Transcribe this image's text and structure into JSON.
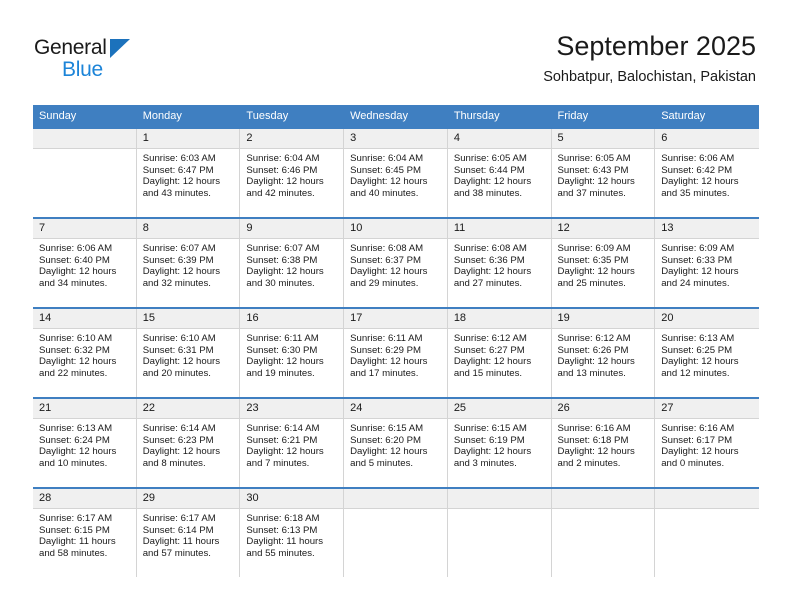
{
  "brand": {
    "name_top": "General",
    "name_bottom": "Blue",
    "accent_color": "#1c84d8",
    "logo_triangle_color": "#1c72bc"
  },
  "header": {
    "title": "September 2025",
    "subtitle": "Sohbatpur, Balochistan, Pakistan",
    "header_bg_color": "#3f7fc1"
  },
  "calendar": {
    "weekday_headers": [
      "Sunday",
      "Monday",
      "Tuesday",
      "Wednesday",
      "Thursday",
      "Friday",
      "Saturday"
    ],
    "weeks": [
      [
        {
          "day": "",
          "empty": true
        },
        {
          "day": "1",
          "sunrise": "Sunrise: 6:03 AM",
          "sunset": "Sunset: 6:47 PM",
          "daylight_line1": "Daylight: 12 hours",
          "daylight_line2": "and 43 minutes."
        },
        {
          "day": "2",
          "sunrise": "Sunrise: 6:04 AM",
          "sunset": "Sunset: 6:46 PM",
          "daylight_line1": "Daylight: 12 hours",
          "daylight_line2": "and 42 minutes."
        },
        {
          "day": "3",
          "sunrise": "Sunrise: 6:04 AM",
          "sunset": "Sunset: 6:45 PM",
          "daylight_line1": "Daylight: 12 hours",
          "daylight_line2": "and 40 minutes."
        },
        {
          "day": "4",
          "sunrise": "Sunrise: 6:05 AM",
          "sunset": "Sunset: 6:44 PM",
          "daylight_line1": "Daylight: 12 hours",
          "daylight_line2": "and 38 minutes."
        },
        {
          "day": "5",
          "sunrise": "Sunrise: 6:05 AM",
          "sunset": "Sunset: 6:43 PM",
          "daylight_line1": "Daylight: 12 hours",
          "daylight_line2": "and 37 minutes."
        },
        {
          "day": "6",
          "sunrise": "Sunrise: 6:06 AM",
          "sunset": "Sunset: 6:42 PM",
          "daylight_line1": "Daylight: 12 hours",
          "daylight_line2": "and 35 minutes."
        }
      ],
      [
        {
          "day": "7",
          "sunrise": "Sunrise: 6:06 AM",
          "sunset": "Sunset: 6:40 PM",
          "daylight_line1": "Daylight: 12 hours",
          "daylight_line2": "and 34 minutes."
        },
        {
          "day": "8",
          "sunrise": "Sunrise: 6:07 AM",
          "sunset": "Sunset: 6:39 PM",
          "daylight_line1": "Daylight: 12 hours",
          "daylight_line2": "and 32 minutes."
        },
        {
          "day": "9",
          "sunrise": "Sunrise: 6:07 AM",
          "sunset": "Sunset: 6:38 PM",
          "daylight_line1": "Daylight: 12 hours",
          "daylight_line2": "and 30 minutes."
        },
        {
          "day": "10",
          "sunrise": "Sunrise: 6:08 AM",
          "sunset": "Sunset: 6:37 PM",
          "daylight_line1": "Daylight: 12 hours",
          "daylight_line2": "and 29 minutes."
        },
        {
          "day": "11",
          "sunrise": "Sunrise: 6:08 AM",
          "sunset": "Sunset: 6:36 PM",
          "daylight_line1": "Daylight: 12 hours",
          "daylight_line2": "and 27 minutes."
        },
        {
          "day": "12",
          "sunrise": "Sunrise: 6:09 AM",
          "sunset": "Sunset: 6:35 PM",
          "daylight_line1": "Daylight: 12 hours",
          "daylight_line2": "and 25 minutes."
        },
        {
          "day": "13",
          "sunrise": "Sunrise: 6:09 AM",
          "sunset": "Sunset: 6:33 PM",
          "daylight_line1": "Daylight: 12 hours",
          "daylight_line2": "and 24 minutes."
        }
      ],
      [
        {
          "day": "14",
          "sunrise": "Sunrise: 6:10 AM",
          "sunset": "Sunset: 6:32 PM",
          "daylight_line1": "Daylight: 12 hours",
          "daylight_line2": "and 22 minutes."
        },
        {
          "day": "15",
          "sunrise": "Sunrise: 6:10 AM",
          "sunset": "Sunset: 6:31 PM",
          "daylight_line1": "Daylight: 12 hours",
          "daylight_line2": "and 20 minutes."
        },
        {
          "day": "16",
          "sunrise": "Sunrise: 6:11 AM",
          "sunset": "Sunset: 6:30 PM",
          "daylight_line1": "Daylight: 12 hours",
          "daylight_line2": "and 19 minutes."
        },
        {
          "day": "17",
          "sunrise": "Sunrise: 6:11 AM",
          "sunset": "Sunset: 6:29 PM",
          "daylight_line1": "Daylight: 12 hours",
          "daylight_line2": "and 17 minutes."
        },
        {
          "day": "18",
          "sunrise": "Sunrise: 6:12 AM",
          "sunset": "Sunset: 6:27 PM",
          "daylight_line1": "Daylight: 12 hours",
          "daylight_line2": "and 15 minutes."
        },
        {
          "day": "19",
          "sunrise": "Sunrise: 6:12 AM",
          "sunset": "Sunset: 6:26 PM",
          "daylight_line1": "Daylight: 12 hours",
          "daylight_line2": "and 13 minutes."
        },
        {
          "day": "20",
          "sunrise": "Sunrise: 6:13 AM",
          "sunset": "Sunset: 6:25 PM",
          "daylight_line1": "Daylight: 12 hours",
          "daylight_line2": "and 12 minutes."
        }
      ],
      [
        {
          "day": "21",
          "sunrise": "Sunrise: 6:13 AM",
          "sunset": "Sunset: 6:24 PM",
          "daylight_line1": "Daylight: 12 hours",
          "daylight_line2": "and 10 minutes."
        },
        {
          "day": "22",
          "sunrise": "Sunrise: 6:14 AM",
          "sunset": "Sunset: 6:23 PM",
          "daylight_line1": "Daylight: 12 hours",
          "daylight_line2": "and 8 minutes."
        },
        {
          "day": "23",
          "sunrise": "Sunrise: 6:14 AM",
          "sunset": "Sunset: 6:21 PM",
          "daylight_line1": "Daylight: 12 hours",
          "daylight_line2": "and 7 minutes."
        },
        {
          "day": "24",
          "sunrise": "Sunrise: 6:15 AM",
          "sunset": "Sunset: 6:20 PM",
          "daylight_line1": "Daylight: 12 hours",
          "daylight_line2": "and 5 minutes."
        },
        {
          "day": "25",
          "sunrise": "Sunrise: 6:15 AM",
          "sunset": "Sunset: 6:19 PM",
          "daylight_line1": "Daylight: 12 hours",
          "daylight_line2": "and 3 minutes."
        },
        {
          "day": "26",
          "sunrise": "Sunrise: 6:16 AM",
          "sunset": "Sunset: 6:18 PM",
          "daylight_line1": "Daylight: 12 hours",
          "daylight_line2": "and 2 minutes."
        },
        {
          "day": "27",
          "sunrise": "Sunrise: 6:16 AM",
          "sunset": "Sunset: 6:17 PM",
          "daylight_line1": "Daylight: 12 hours",
          "daylight_line2": "and 0 minutes."
        }
      ],
      [
        {
          "day": "28",
          "sunrise": "Sunrise: 6:17 AM",
          "sunset": "Sunset: 6:15 PM",
          "daylight_line1": "Daylight: 11 hours",
          "daylight_line2": "and 58 minutes."
        },
        {
          "day": "29",
          "sunrise": "Sunrise: 6:17 AM",
          "sunset": "Sunset: 6:14 PM",
          "daylight_line1": "Daylight: 11 hours",
          "daylight_line2": "and 57 minutes."
        },
        {
          "day": "30",
          "sunrise": "Sunrise: 6:18 AM",
          "sunset": "Sunset: 6:13 PM",
          "daylight_line1": "Daylight: 11 hours",
          "daylight_line2": "and 55 minutes."
        },
        {
          "day": "",
          "empty": true
        },
        {
          "day": "",
          "empty": true
        },
        {
          "day": "",
          "empty": true
        },
        {
          "day": "",
          "empty": true
        }
      ]
    ]
  }
}
